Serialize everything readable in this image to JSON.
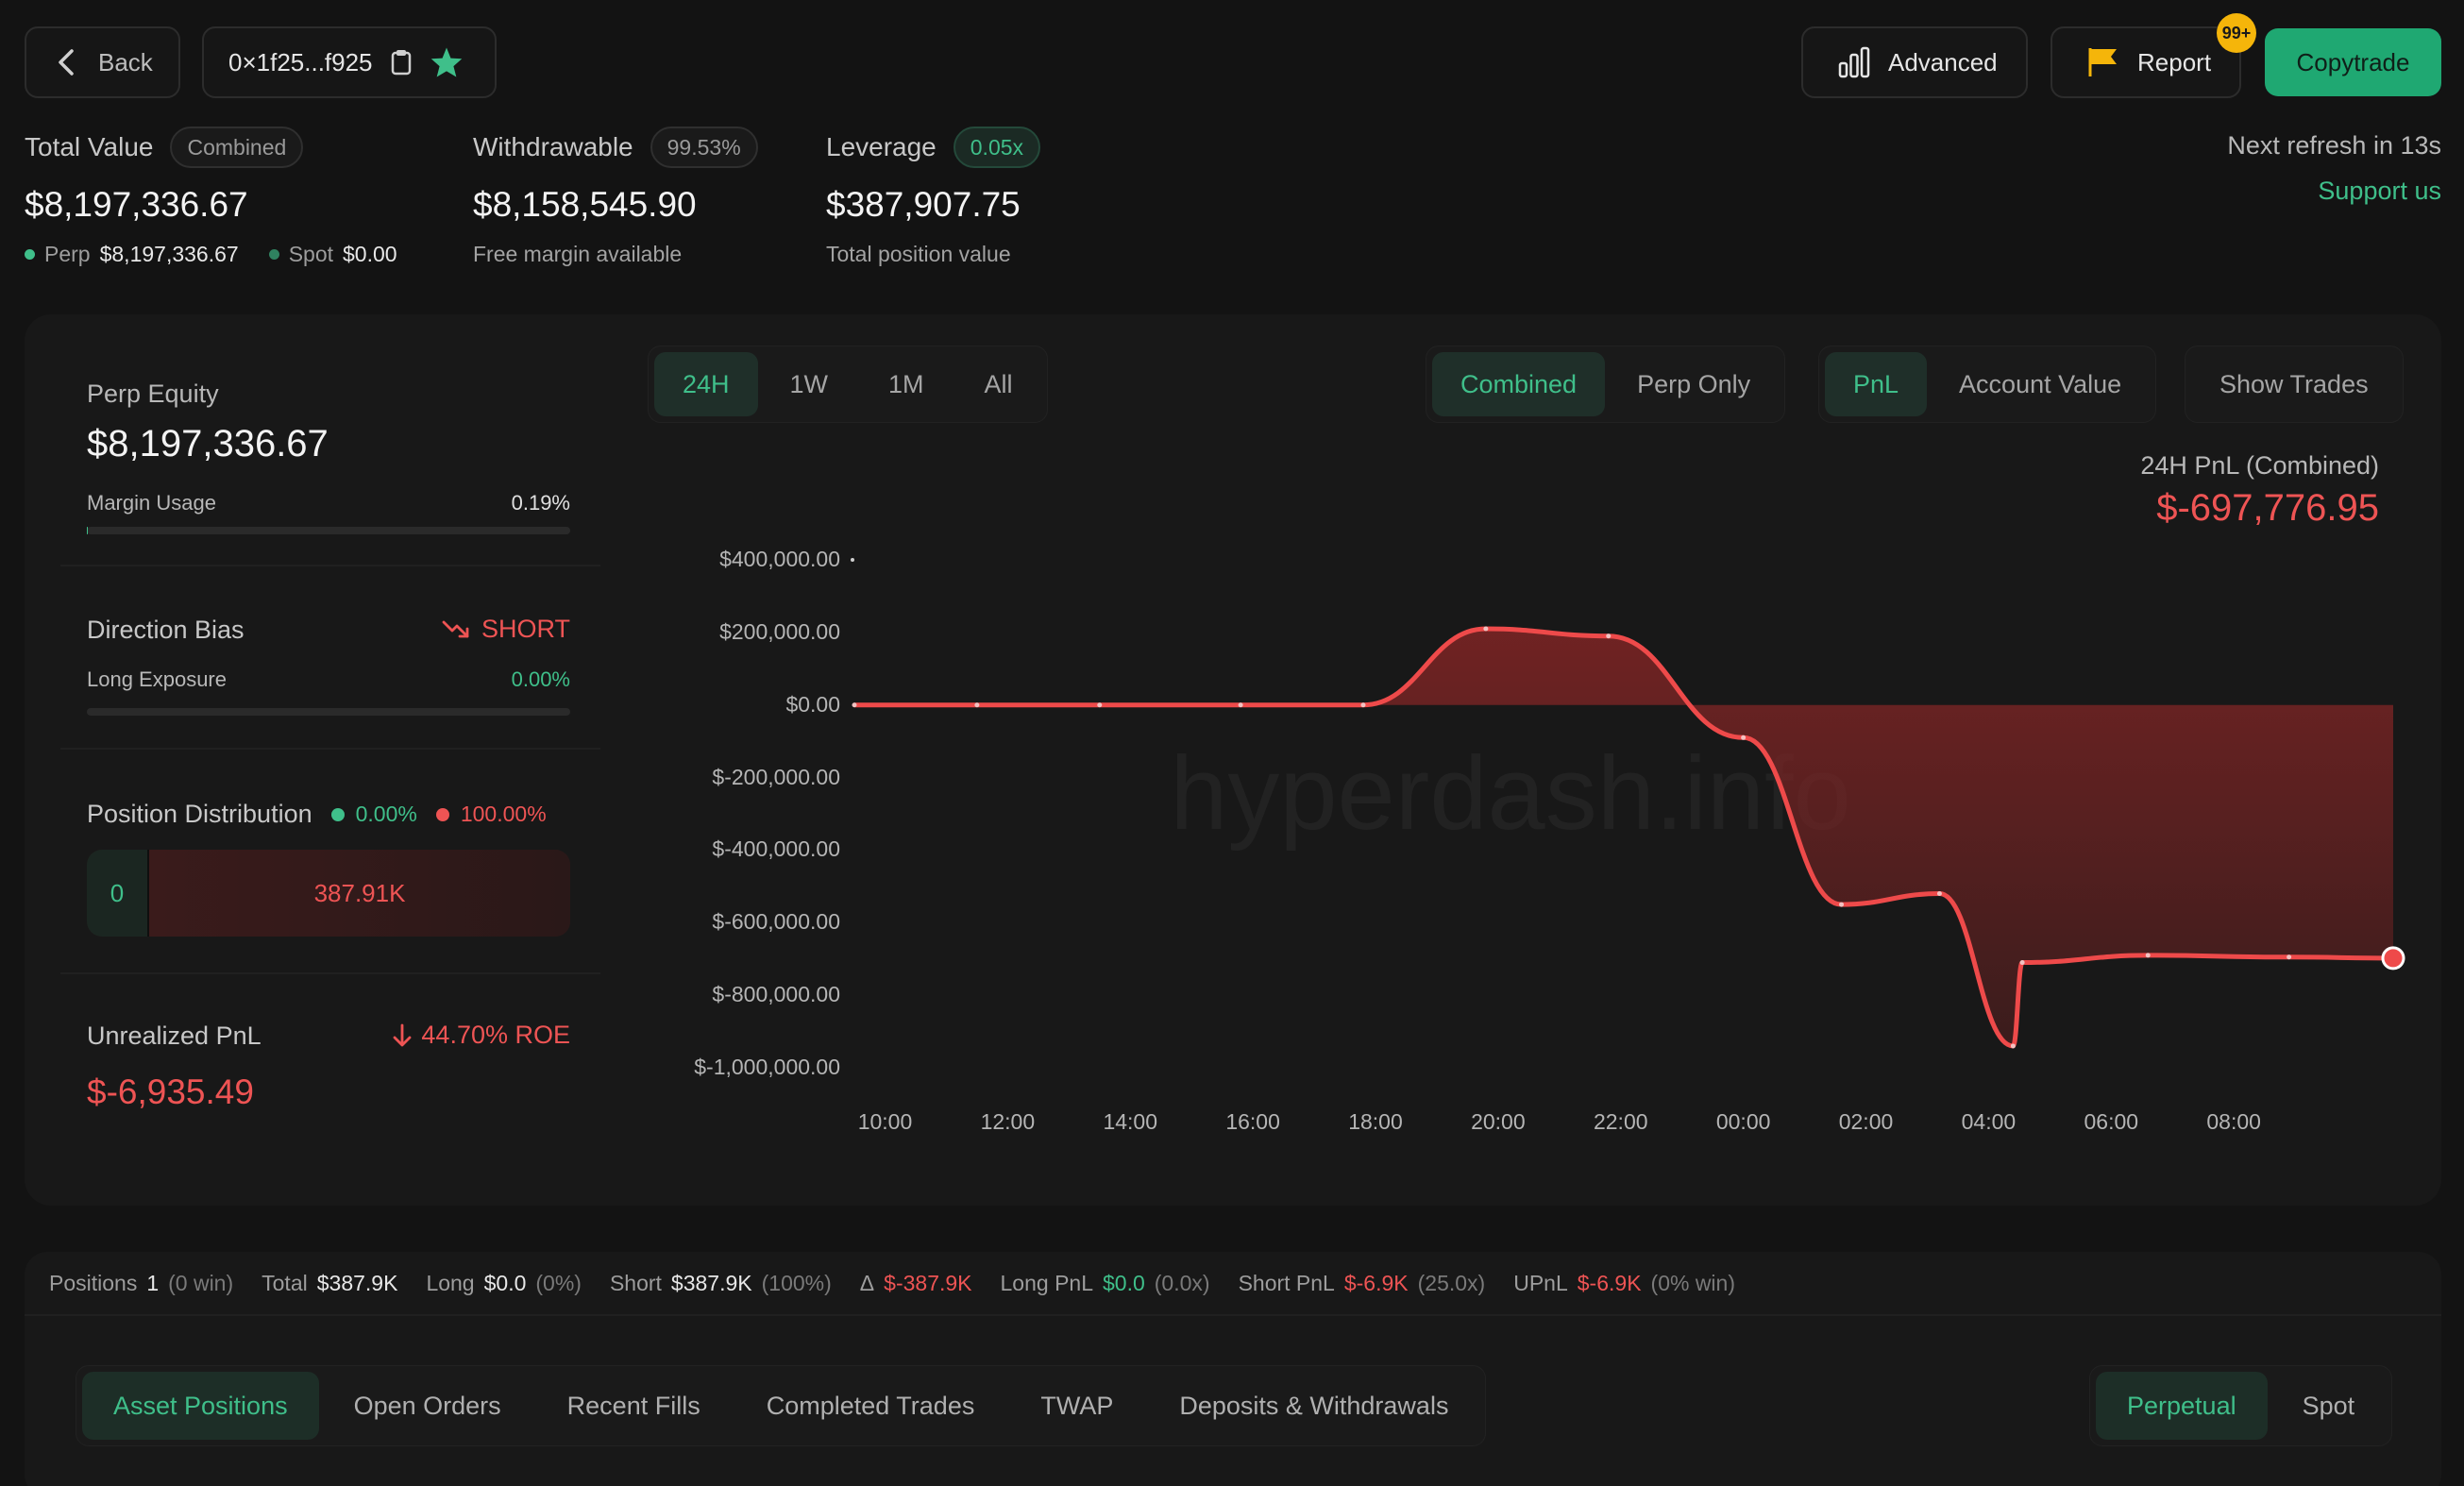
{
  "header": {
    "back_label": "Back",
    "address": "0×1f25...f925",
    "advanced_label": "Advanced",
    "report_label": "Report",
    "report_badge": "99+",
    "copytrade_label": "Copytrade",
    "refresh_text": "Next refresh in 13s",
    "support_label": "Support us"
  },
  "summary": {
    "total_value": {
      "label": "Total Value",
      "badge": "Combined",
      "value": "$8,197,336.67",
      "perp_label": "Perp",
      "perp_value": "$8,197,336.67",
      "spot_label": "Spot",
      "spot_value": "$0.00"
    },
    "withdrawable": {
      "label": "Withdrawable",
      "badge": "99.53%",
      "value": "$8,158,545.90",
      "sub": "Free margin available"
    },
    "leverage": {
      "label": "Leverage",
      "badge": "0.05x",
      "value": "$387,907.75",
      "sub": "Total position value"
    }
  },
  "left_panel": {
    "perp_equity_label": "Perp Equity",
    "perp_equity_value": "$8,197,336.67",
    "margin_usage_label": "Margin Usage",
    "margin_usage_value": "0.19%",
    "margin_usage_fraction": 0.0019,
    "direction_bias_label": "Direction Bias",
    "direction_bias_value": "SHORT",
    "long_exposure_label": "Long Exposure",
    "long_exposure_value": "0.00%",
    "long_exposure_fraction": 0.0,
    "position_distribution_label": "Position Distribution",
    "dist_long_pct": "0.00%",
    "dist_short_pct": "100.00%",
    "dist_long_value": "0",
    "dist_short_value": "387.91K",
    "unrealized_pnl_label": "Unrealized PnL",
    "roe_text": "44.70% ROE",
    "unrealized_pnl_value": "$-6,935.49"
  },
  "chart_controls": {
    "ranges": [
      "24H",
      "1W",
      "1M",
      "All"
    ],
    "active_range": "24H",
    "modes": [
      "Combined",
      "Perp Only"
    ],
    "active_mode": "Combined",
    "metrics": [
      "PnL",
      "Account Value"
    ],
    "active_metric": "PnL",
    "show_trades_label": "Show Trades",
    "pnl_title": "24H PnL (Combined)",
    "pnl_value": "$-697,776.95",
    "watermark": "hyperdash.info"
  },
  "chart_data": {
    "type": "area",
    "y_tick_labels": [
      "$400,000.00",
      "$200,000.00",
      "$0.00",
      "$-200,000.00",
      "$-400,000.00",
      "$-600,000.00",
      "$-800,000.00",
      "$-1,000,000.00"
    ],
    "y_ticks": [
      400000,
      200000,
      0,
      -200000,
      -400000,
      -600000,
      -800000,
      -1000000
    ],
    "x_tick_labels": [
      "10:00",
      "12:00",
      "14:00",
      "16:00",
      "18:00",
      "20:00",
      "22:00",
      "00:00",
      "02:00",
      "04:00",
      "06:00",
      "08:00"
    ],
    "ylim": [
      -1000000,
      400000
    ],
    "x": [
      9.5,
      11.5,
      13.5,
      15.8,
      17.8,
      19.8,
      21.8,
      24.0,
      25.6,
      27.2,
      28.4,
      28.55,
      30.6,
      32.9,
      34.6
    ],
    "y": [
      0,
      0,
      0,
      0,
      0,
      210000,
      190000,
      -90000,
      -550000,
      -520000,
      -940000,
      -710000,
      -690000,
      -695000,
      -697777
    ],
    "xlim": [
      9.5,
      34.6
    ],
    "series": [
      {
        "values": [
          0,
          0,
          0,
          0,
          0,
          210000,
          190000,
          -90000,
          -550000,
          -520000,
          -940000,
          -710000,
          -690000,
          -695000,
          -697777
        ]
      }
    ],
    "line_color": "#ee4a4a",
    "fill_color": "#7a2424"
  },
  "stats_bar": {
    "positions_label": "Positions",
    "positions_value": "1",
    "positions_note": "(0 win)",
    "total_label": "Total",
    "total_value": "$387.9K",
    "long_label": "Long",
    "long_value": "$0.0",
    "long_note": "(0%)",
    "short_label": "Short",
    "short_value": "$387.9K",
    "short_note": "(100%)",
    "delta_label": "Δ",
    "delta_value": "$-387.9K",
    "longpnl_label": "Long PnL",
    "longpnl_value": "$0.0",
    "longpnl_note": "(0.0x)",
    "shortpnl_label": "Short PnL",
    "shortpnl_value": "$-6.9K",
    "shortpnl_note": "(25.0x)",
    "upnl_label": "UPnL",
    "upnl_value": "$-6.9K",
    "upnl_note": "(0% win)"
  },
  "bottom_tabs": {
    "tabs": [
      "Asset Positions",
      "Open Orders",
      "Recent Fills",
      "Completed Trades",
      "TWAP",
      "Deposits & Withdrawals"
    ],
    "active": "Asset Positions",
    "market_types": [
      "Perpetual",
      "Spot"
    ],
    "active_market": "Perpetual"
  },
  "colors": {
    "accent_green": "#3fbf8a",
    "accent_red": "#ee5454",
    "badge_yellow": "#f5b50a"
  }
}
